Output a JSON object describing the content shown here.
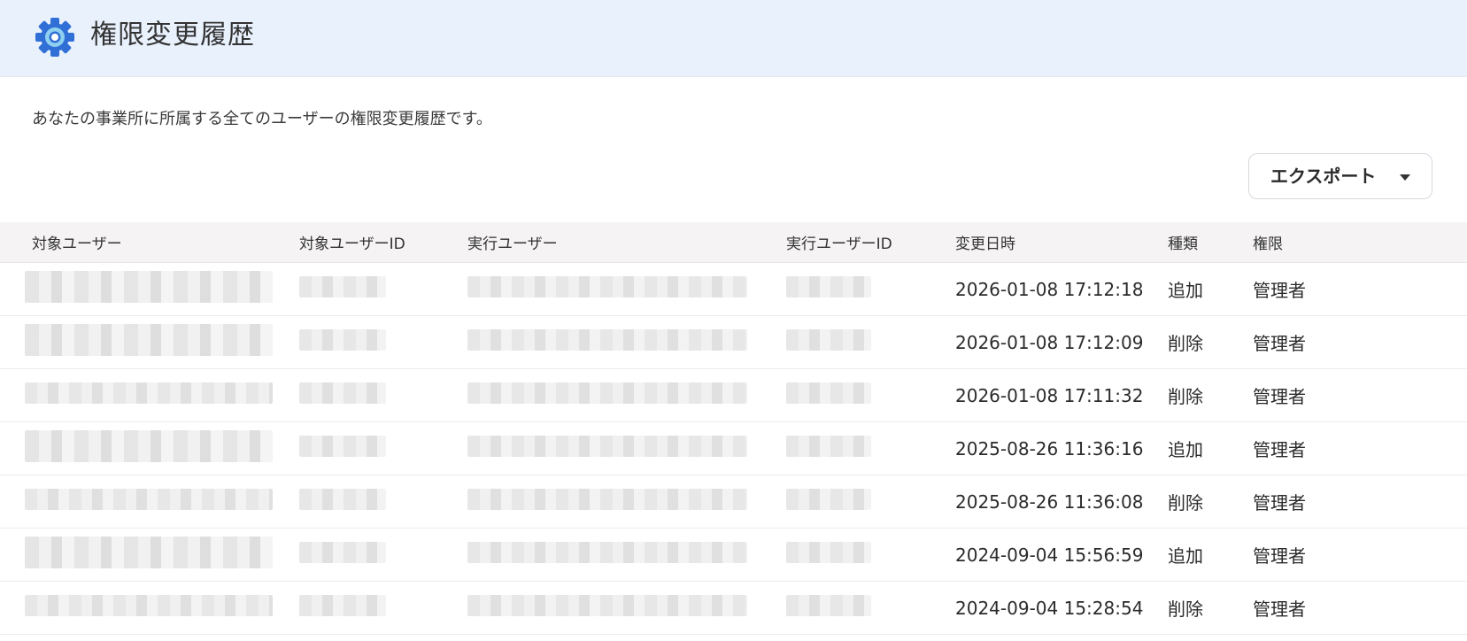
{
  "header": {
    "title": "権限変更履歴",
    "icon": "gear-icon",
    "accent_color": "#2f6fd6"
  },
  "description": "あなたの事業所に所属する全てのユーザーの権限変更履歴です。",
  "export_button": {
    "label": "エクスポート"
  },
  "table": {
    "columns": [
      "対象ユーザー",
      "対象ユーザーID",
      "実行ユーザー",
      "実行ユーザーID",
      "変更日時",
      "種類",
      "権限"
    ],
    "rows": [
      {
        "changed_at": "2026-01-08 17:12:18",
        "type": "追加",
        "permission": "管理者"
      },
      {
        "changed_at": "2026-01-08 17:12:09",
        "type": "削除",
        "permission": "管理者"
      },
      {
        "changed_at": "2026-01-08 17:11:32",
        "type": "削除",
        "permission": "管理者"
      },
      {
        "changed_at": "2025-08-26 11:36:16",
        "type": "追加",
        "permission": "管理者"
      },
      {
        "changed_at": "2025-08-26 11:36:08",
        "type": "削除",
        "permission": "管理者"
      },
      {
        "changed_at": "2024-09-04 15:56:59",
        "type": "追加",
        "permission": "管理者"
      },
      {
        "changed_at": "2024-09-04 15:28:54",
        "type": "削除",
        "permission": "管理者"
      }
    ]
  }
}
